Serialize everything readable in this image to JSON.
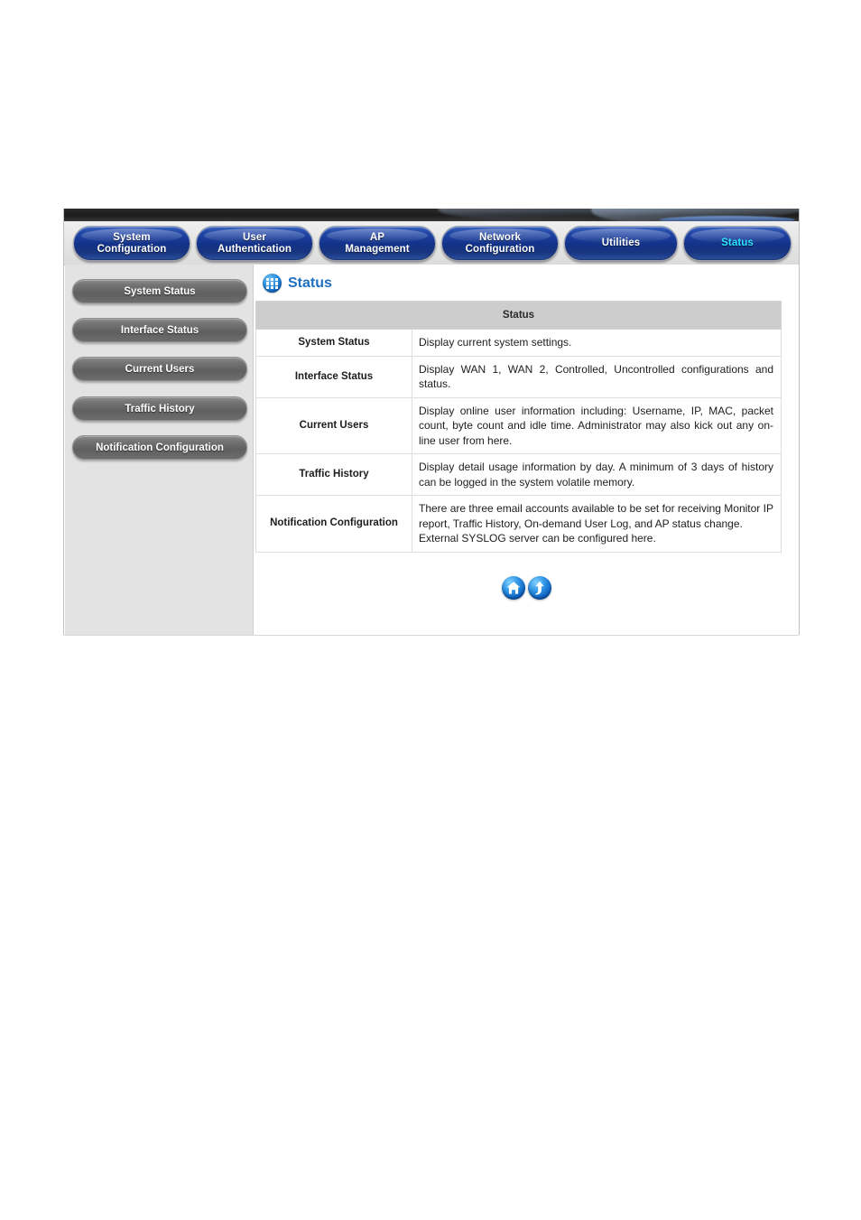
{
  "nav": {
    "items": [
      {
        "id": "system-configuration",
        "label_lines": [
          "System",
          "Configuration"
        ],
        "active": false
      },
      {
        "id": "user-authentication",
        "label_lines": [
          "User",
          "Authentication"
        ],
        "active": false
      },
      {
        "id": "ap-management",
        "label_lines": [
          "AP",
          "Management"
        ],
        "active": false
      },
      {
        "id": "network-configuration",
        "label_lines": [
          "Network",
          "Configuration"
        ],
        "active": false
      },
      {
        "id": "utilities",
        "label_lines": [
          "Utilities"
        ],
        "active": false
      },
      {
        "id": "status",
        "label_lines": [
          "Status"
        ],
        "active": true
      }
    ]
  },
  "sidebar": {
    "items": [
      {
        "id": "system-status",
        "label": "System Status"
      },
      {
        "id": "interface-status",
        "label": "Interface Status"
      },
      {
        "id": "current-users",
        "label": "Current Users"
      },
      {
        "id": "traffic-history",
        "label": "Traffic History"
      },
      {
        "id": "notification-configuration",
        "label": "Notification Configuration"
      }
    ]
  },
  "page": {
    "title": "Status",
    "icon": "grid-icon"
  },
  "table": {
    "header": "Status",
    "rows": [
      {
        "label": "System Status",
        "desc": "Display current system settings.",
        "desc2": ""
      },
      {
        "label": "Interface Status",
        "desc": "Display WAN 1, WAN 2, Controlled, Uncontrolled configurations and status.",
        "desc2": ""
      },
      {
        "label": "Current Users",
        "desc": "Display online user information including: Username, IP, MAC, packet count, byte count and idle time. Administrator may also kick out any on-line user from here.",
        "desc2": ""
      },
      {
        "label": "Traffic History",
        "desc": "Display detail usage information by day. A minimum of 3 days of history can be logged in the system volatile memory.",
        "desc2": ""
      },
      {
        "label": "Notification Configuration",
        "desc": "There are three email accounts available to be set for receiving Monitor IP report, Traffic History, On-demand User Log, and AP status change.",
        "desc2": "External SYSLOG server can be configured here."
      }
    ]
  },
  "footer": {
    "icons": [
      {
        "id": "home-icon",
        "name": "home"
      },
      {
        "id": "back-to-top-icon",
        "name": "up-arrow"
      }
    ]
  },
  "colors": {
    "nav_button": "#133289",
    "nav_active_text": "#2ee3ff",
    "sidebar_button": "#5f5f5f",
    "sidebar_panel": "#e3e3e3",
    "table_header": "#cdcdcd",
    "title_text": "#1f6fc4"
  }
}
